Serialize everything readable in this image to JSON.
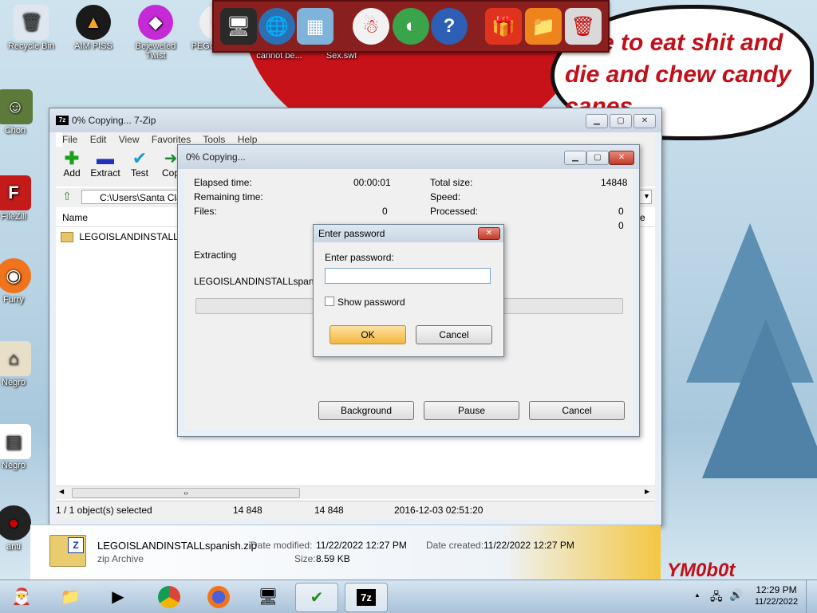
{
  "desktop": {
    "bubble_text": "time to eat shit and die and chew candy canes",
    "watermark": "YM0b0t",
    "icons": [
      {
        "label": "Recycle Bin",
        "icon": "recycle-bin-icon"
      },
      {
        "label": "AIM PISS",
        "icon": "aimp-icon"
      },
      {
        "label": "Bejeweled Twist",
        "icon": "bejeweled-icon"
      },
      {
        "label": "PEGGLE ME",
        "icon": "peggle-icon"
      },
      {
        "label": "I SERIOUSLY cannot be...",
        "icon": "file-icon"
      },
      {
        "label": "Binding Of Sex.swf",
        "icon": "swf-icon"
      },
      {
        "label": "Chon",
        "icon": "app-icon"
      },
      {
        "label": "FileZill",
        "icon": "filezilla-icon"
      },
      {
        "label": "Furry",
        "icon": "firefox-icon"
      },
      {
        "label": "Negro",
        "icon": "home-icon"
      },
      {
        "label": "Negro",
        "icon": "app-icon"
      },
      {
        "label": "anti",
        "icon": "app-icon"
      }
    ]
  },
  "main_window": {
    "title": "0% Copying... 7-Zip",
    "menu": [
      "File",
      "Edit",
      "View",
      "Favorites",
      "Tools",
      "Help"
    ],
    "toolbar": [
      "Add",
      "Extract",
      "Test",
      "Cop"
    ],
    "path": "C:\\Users\\Santa Cla",
    "col_name": "Name",
    "col_right": "ute",
    "file_row": "LEGOISLANDINSTALLsp...",
    "status": {
      "selected": "1 / 1 object(s) selected",
      "size": "14 848",
      "packed": "14 848",
      "date": "2016-12-03 02:51:20"
    }
  },
  "copy_dialog": {
    "title": "0% Copying...",
    "elapsed_label": "Elapsed time:",
    "elapsed_value": "00:00:01",
    "remaining_label": "Remaining time:",
    "files_label": "Files:",
    "files_value": "0",
    "total_label": "Total size:",
    "total_value": "14848",
    "speed_label": "Speed:",
    "processed_label": "Processed:",
    "processed_value": "0",
    "compressed_value": "0",
    "extracting": "Extracting",
    "filename": "LEGOISLANDINSTALLspanish.",
    "progress": 0,
    "btn_background": "Background",
    "btn_pause": "Pause",
    "btn_cancel": "Cancel"
  },
  "password_dialog": {
    "title": "Enter password",
    "label": "Enter password:",
    "value": "",
    "show_password": "Show password",
    "ok": "OK",
    "cancel": "Cancel"
  },
  "details_bar": {
    "filename": "LEGOISLANDINSTALLspanish.zip",
    "type": "zip Archive",
    "modified_label": "Date modified:",
    "modified_value": "11/22/2022 12:27 PM",
    "created_label": "Date created:",
    "created_value": "11/22/2022 12:27 PM",
    "size_label": "Size:",
    "size_value": "8.59 KB"
  },
  "taskbar": {
    "time": "12:29 PM",
    "date": "11/22/2022"
  }
}
